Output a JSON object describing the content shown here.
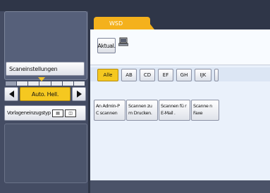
{
  "left": {
    "scan_settings_label": "Scaneinstellungen",
    "auto_density_label": "Auto. Hell.",
    "original_feed_label": "Vorlageneinzugstyp"
  },
  "tabs": {
    "wsd_label": "WSD"
  },
  "toolbar": {
    "refresh_label": "Aktual."
  },
  "letters": [
    {
      "label": "Alle",
      "active": true
    },
    {
      "label": "AB"
    },
    {
      "label": "CD"
    },
    {
      "label": "EF"
    },
    {
      "label": "GH"
    },
    {
      "label": "IJK"
    }
  ],
  "destinations": [
    {
      "label": "An Admin-P C scannen"
    },
    {
      "label": "Scannen zu m Drucken."
    },
    {
      "label": "Scannen fü r E-Mail ."
    },
    {
      "label": "Scanne n Faxe"
    }
  ],
  "colors": {
    "accent": "#f4b11c",
    "selected": "#f5c820",
    "panel": "#eaf1fb",
    "dark": "#444c63"
  }
}
